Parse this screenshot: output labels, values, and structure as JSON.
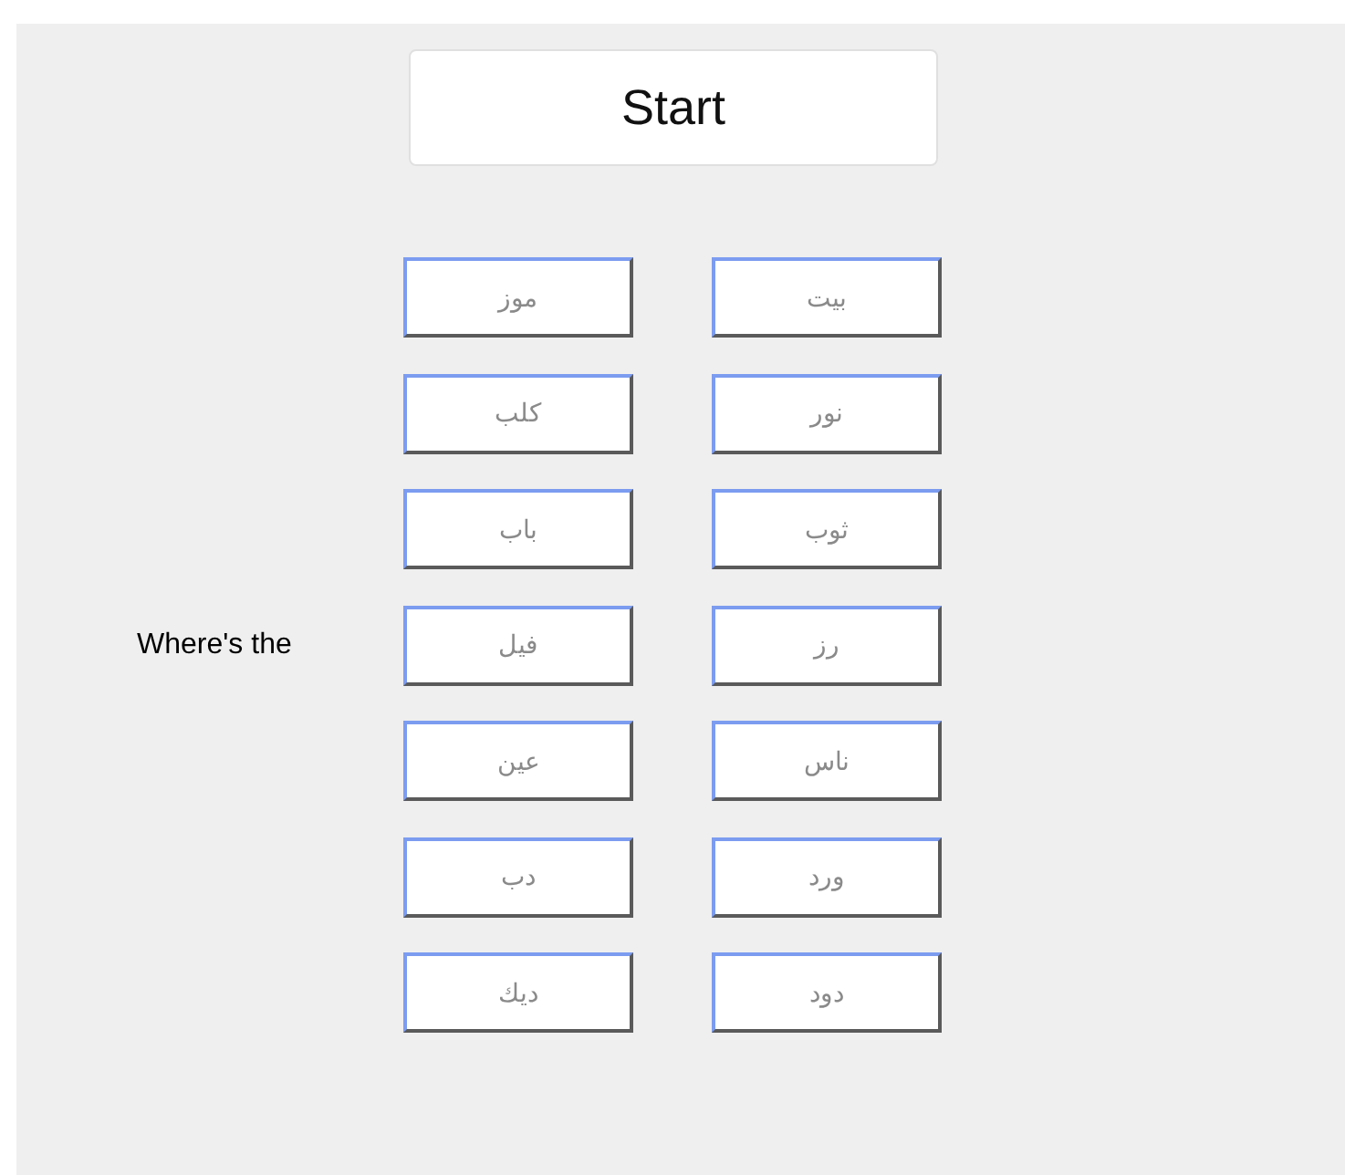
{
  "start_button": {
    "label": "Start"
  },
  "rows": [
    {
      "left": {
        "label": "موز",
        "disabled": true
      },
      "right": {
        "label": "بيت",
        "disabled": true
      }
    },
    {
      "left": {
        "label": "كلب",
        "disabled": true
      },
      "right": {
        "label": "نور",
        "disabled": true
      }
    },
    {
      "left": {
        "label": "باب",
        "disabled": true
      },
      "right": {
        "label": "ثوب",
        "disabled": true
      }
    },
    {
      "prompt": "Where's the",
      "left": {
        "label": "فيل",
        "disabled": true
      },
      "right": {
        "label": "رز",
        "disabled": true
      }
    },
    {
      "left": {
        "label": "عين",
        "disabled": true
      },
      "right": {
        "label": "ناس",
        "disabled": true
      }
    },
    {
      "left": {
        "label": "دب",
        "disabled": true
      },
      "right": {
        "label": "ورد",
        "disabled": true
      }
    },
    {
      "left": {
        "label": "ديك",
        "disabled": true
      },
      "right": {
        "label": "دود",
        "disabled": true
      }
    }
  ]
}
